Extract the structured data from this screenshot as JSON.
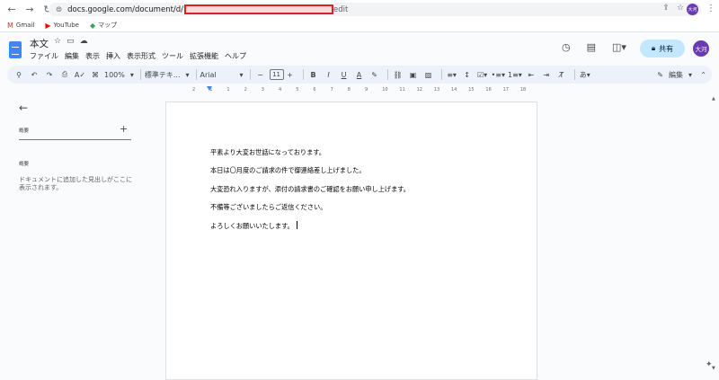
{
  "browser": {
    "url_prefix": "docs.google.com/document/d/",
    "url_suffix": "edit",
    "avatar_text": "大河"
  },
  "bookmarks": [
    {
      "label": "Gmail",
      "icon": "gmail-icon"
    },
    {
      "label": "YouTube",
      "icon": "youtube-icon"
    },
    {
      "label": "マップ",
      "icon": "maps-icon"
    }
  ],
  "doc": {
    "title": "本文",
    "menus": [
      "ファイル",
      "編集",
      "表示",
      "挿入",
      "表示形式",
      "ツール",
      "拡張機能",
      "ヘルプ"
    ],
    "share_label": "共有",
    "avatar_text": "大河"
  },
  "toolbar": {
    "zoom": "100%",
    "style": "標準テキ...",
    "font": "Arial",
    "font_size": "11",
    "mode": "編集"
  },
  "ruler": {
    "numbers": [
      "2",
      "1",
      "1",
      "2",
      "3",
      "4",
      "5",
      "6",
      "7",
      "8",
      "9",
      "10",
      "11",
      "12",
      "13",
      "14",
      "15",
      "16",
      "17",
      "18"
    ]
  },
  "outline": {
    "heading": "概要",
    "summary_heading": "概要",
    "hint": "ドキュメントに追加した見出しがここに表示されます。"
  },
  "body": {
    "paragraphs": [
      "平素より大変お世話になっております。",
      "本日は〇月度のご請求の件で御連絡差し上げました。",
      "大変恐れ入りますが、添付の請求書のご確認をお願い申し上げます。",
      "不備等ございましたらご返信ください。",
      "よろしくお願いいたします。"
    ]
  },
  "colors": {
    "accent": "#4285f4",
    "share_bg": "#c2e7ff",
    "avatar": "#6a3ab2",
    "redaction": "#e02020"
  }
}
